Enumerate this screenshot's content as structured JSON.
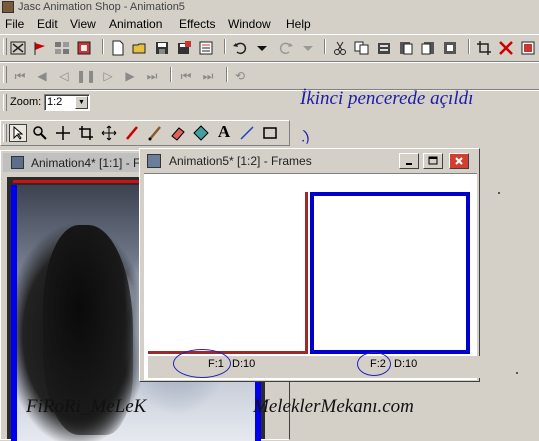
{
  "window": {
    "title": "Jasc Animation Shop - Animation5"
  },
  "menu": {
    "items": [
      "File",
      "Edit",
      "View",
      "Animation",
      "Effects",
      "Window",
      "Help"
    ]
  },
  "toolbar_zoom": {
    "label": "Zoom:",
    "value": "1:2"
  },
  "caption": "İkinci pencerede açıldı",
  "windows": {
    "animation4": {
      "title": "Animation4* [1:1] - F"
    },
    "animation5": {
      "title": "Animation5* [1:2] - Frames",
      "frames": [
        {
          "frame_label": "F:1",
          "delay_label": "D:10"
        },
        {
          "frame_label": "F:2",
          "delay_label": "D:10"
        }
      ]
    }
  },
  "watermarks": {
    "left": "FiRoRi_MeLeK",
    "right": "MeleklerMekanı.com"
  },
  "icons": {
    "main_toolbar": [
      "mark-icon",
      "flag-icon",
      "frame-icon",
      "film-icon",
      "new-icon",
      "open-icon",
      "save-icon",
      "save-as-icon",
      "undo-icon",
      "dropdown-icon",
      "redo-icon",
      "dropdown-icon",
      "cut-icon",
      "copy-icon",
      "paste-icon",
      "paste-before-icon",
      "paste-after-icon",
      "paste-into-icon",
      "crop-icon",
      "delete-icon",
      "properties-icon"
    ],
    "playback_toolbar": [
      "first-frame-icon",
      "prev-frame-icon",
      "play-back-icon",
      "pause-icon",
      "play-icon",
      "next-frame-icon",
      "last-frame-icon",
      "loop-icon"
    ],
    "tools": [
      "arrow-tool-icon",
      "zoom-tool-icon",
      "move-tool-icon",
      "crop-tool-icon",
      "pan-tool-icon",
      "brush-tool-icon",
      "dropper-tool-icon",
      "eraser-tool-icon",
      "fill-tool-icon",
      "text-tool-icon",
      "line-tool-icon",
      "rectangle-tool-icon"
    ]
  },
  "colors": {
    "caption": "#1c1ca8",
    "frame_red": "#9b2b2b",
    "frame_blue": "#0000cc",
    "circle": "#2020c0"
  }
}
